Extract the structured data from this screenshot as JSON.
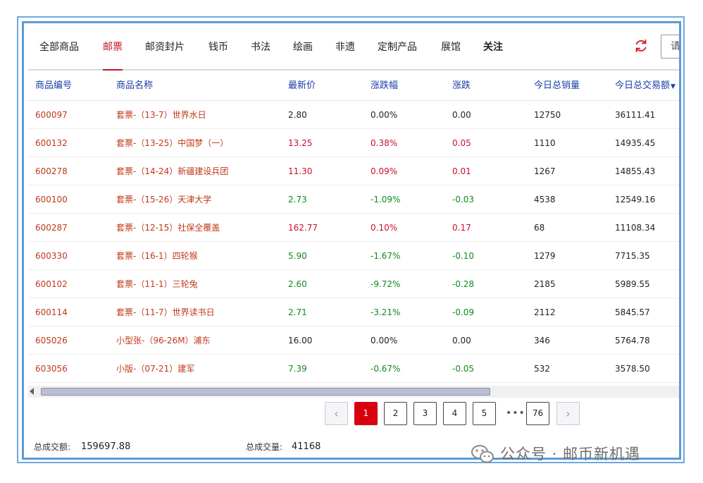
{
  "tabs": [
    {
      "label": "全部商品",
      "active": false
    },
    {
      "label": "邮票",
      "active": true
    },
    {
      "label": "邮资封片",
      "active": false
    },
    {
      "label": "钱币",
      "active": false
    },
    {
      "label": "书法",
      "active": false
    },
    {
      "label": "绘画",
      "active": false
    },
    {
      "label": "非遗",
      "active": false
    },
    {
      "label": "定制产品",
      "active": false
    },
    {
      "label": "展馆",
      "active": false
    },
    {
      "label": "关注",
      "active": false
    }
  ],
  "search": {
    "placeholder": "请"
  },
  "table": {
    "headers": {
      "code": "商品编号",
      "name": "商品名称",
      "price": "最新价",
      "pct": "涨跌幅",
      "chg": "涨跌",
      "vol": "今日总销量",
      "amt": "今日总交易额",
      "sort_indicator": "▼"
    },
    "rows": [
      {
        "code": "600097",
        "name": "套票-（13-7）世界水日",
        "price": "2.80",
        "pct": "0.00%",
        "chg": "0.00",
        "vol": "12750",
        "amt": "36111.41",
        "trend": "flat"
      },
      {
        "code": "600132",
        "name": "套票-（13-25）中国梦（一）",
        "price": "13.25",
        "pct": "0.38%",
        "chg": "0.05",
        "vol": "1110",
        "amt": "14935.45",
        "trend": "up"
      },
      {
        "code": "600278",
        "name": "套票-（14-24）新疆建设兵团",
        "price": "11.30",
        "pct": "0.09%",
        "chg": "0.01",
        "vol": "1267",
        "amt": "14855.43",
        "trend": "up"
      },
      {
        "code": "600100",
        "name": "套票-（15-26）天津大学",
        "price": "2.73",
        "pct": "-1.09%",
        "chg": "-0.03",
        "vol": "4538",
        "amt": "12549.16",
        "trend": "down"
      },
      {
        "code": "600287",
        "name": "套票-（12-15）社保全覆盖",
        "price": "162.77",
        "pct": "0.10%",
        "chg": "0.17",
        "vol": "68",
        "amt": "11108.34",
        "trend": "up"
      },
      {
        "code": "600330",
        "name": "套票-（16-1）四轮猴",
        "price": "5.90",
        "pct": "-1.67%",
        "chg": "-0.10",
        "vol": "1279",
        "amt": "7715.35",
        "trend": "down"
      },
      {
        "code": "600102",
        "name": "套票-（11-1）三轮兔",
        "price": "2.60",
        "pct": "-9.72%",
        "chg": "-0.28",
        "vol": "2185",
        "amt": "5989.55",
        "trend": "down"
      },
      {
        "code": "600114",
        "name": "套票-（11-7）世界读书日",
        "price": "2.71",
        "pct": "-3.21%",
        "chg": "-0.09",
        "vol": "2112",
        "amt": "5845.57",
        "trend": "down"
      },
      {
        "code": "605026",
        "name": "小型张-（96-26M）浦东",
        "price": "16.00",
        "pct": "0.00%",
        "chg": "0.00",
        "vol": "346",
        "amt": "5764.78",
        "trend": "flat"
      },
      {
        "code": "603056",
        "name": "小版-（07-21）建军",
        "price": "7.39",
        "pct": "-0.67%",
        "chg": "-0.05",
        "vol": "532",
        "amt": "3578.50",
        "trend": "down"
      }
    ]
  },
  "pagination": {
    "prev": "‹",
    "next": "›",
    "pages": [
      "1",
      "2",
      "3",
      "4",
      "5"
    ],
    "ellipsis": "•••",
    "last": "76",
    "current": "1"
  },
  "footer": {
    "total_amount_label": "总成交额:",
    "total_amount": "159697.88",
    "total_volume_label": "总成交量:",
    "total_volume": "41168"
  },
  "watermark": {
    "text": "公众号 · 邮币新机遇"
  },
  "colors": {
    "accent": "#c0151f",
    "up": "#c8102e",
    "down": "#0f8a1e",
    "header_text": "#1a3fa8",
    "frame": "#5b9bd5"
  }
}
